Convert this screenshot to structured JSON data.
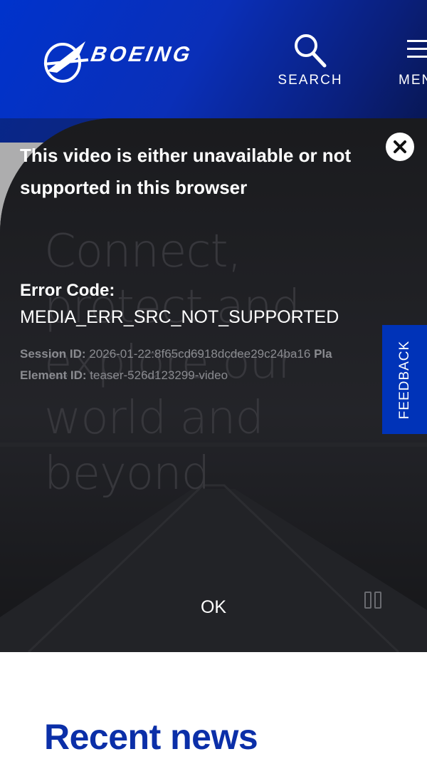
{
  "header": {
    "logo_text": "BOEING",
    "search_label": "SEARCH",
    "menu_label": "MENU"
  },
  "hero": {
    "line1": "Connect,",
    "line2": "protect and",
    "line3": "explore our",
    "line4": "world and",
    "line5": "beyond"
  },
  "error": {
    "title": "This video is either unavailable or not supported in this browser",
    "code_label": "Error Code:",
    "code": "MEDIA_ERR_SRC_NOT_SUPPORTED",
    "session_label": "Session ID:",
    "session_value": "2026-01-22:8f65cd6918dcdee29c24ba16",
    "player_label": "Pla",
    "element_label": "Element ID:",
    "element_value": "teaser-526d123299-video",
    "ok_label": "OK"
  },
  "feedback": {
    "label": "FEEDBACK"
  },
  "recent": {
    "title": "Recent news"
  },
  "colors": {
    "brand_blue": "#0033b8",
    "header_gradient_start": "#0033cc",
    "recent_title": "#0b2fa8"
  },
  "icons": {
    "search": "search-icon",
    "menu": "menu-icon",
    "close": "close-icon",
    "pause": "pause-icon",
    "logo": "boeing-logo"
  }
}
